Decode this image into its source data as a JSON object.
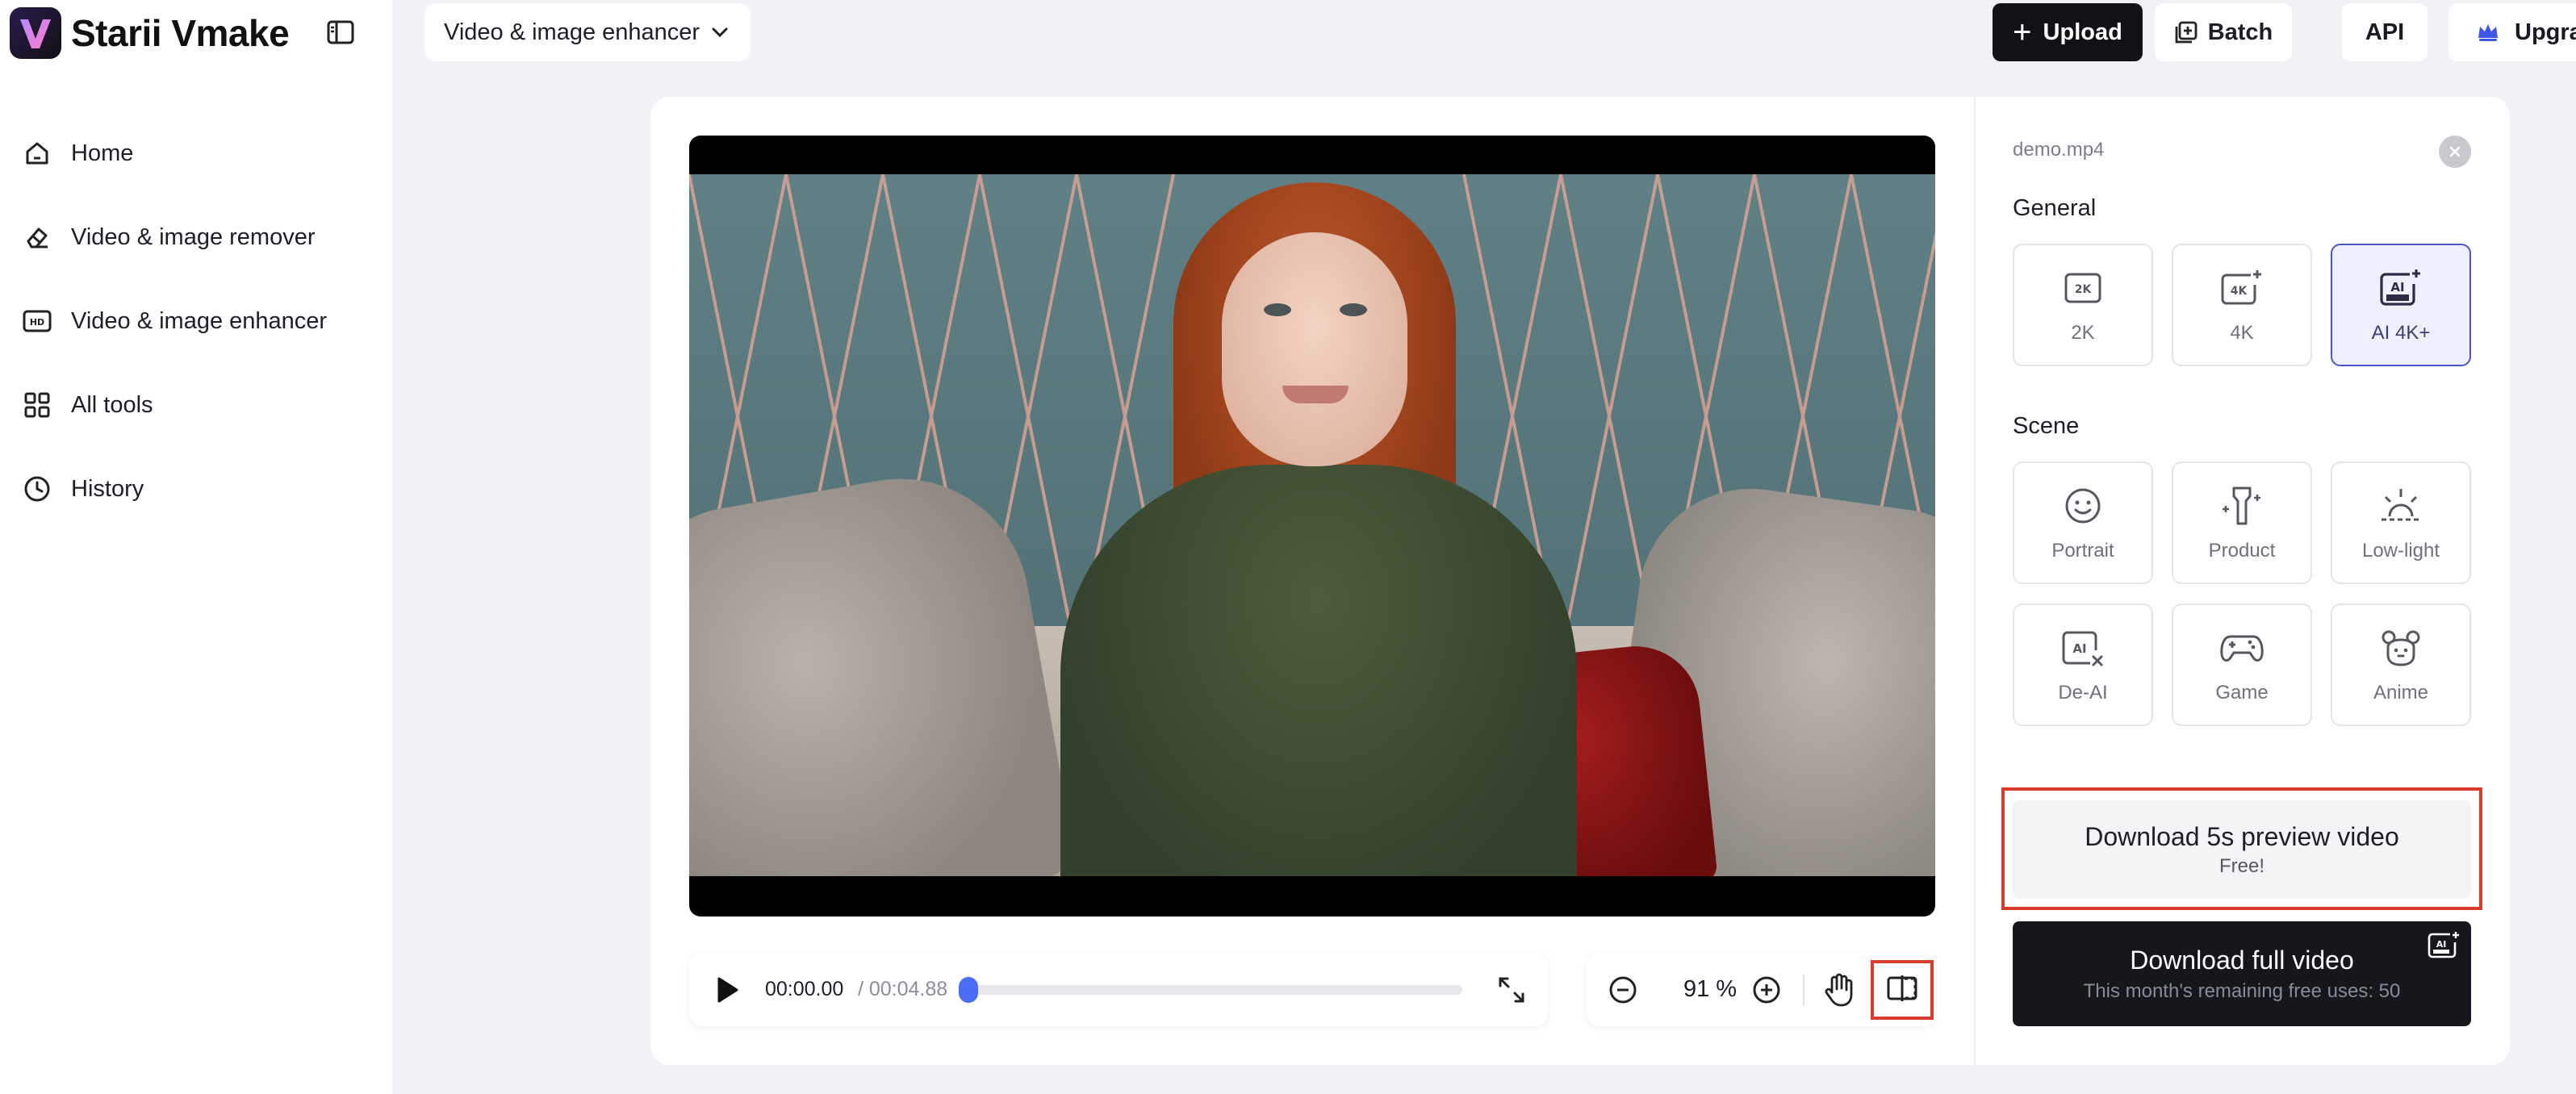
{
  "app": {
    "brand_name": "Starii Vmake",
    "accent_color": "#4a6cf7",
    "highlight_color": "#d93b2e"
  },
  "sidebar": {
    "items": [
      {
        "label": "Home",
        "icon": "home-icon"
      },
      {
        "label": "Video & image remover",
        "icon": "eraser-icon"
      },
      {
        "label": "Video & image enhancer",
        "icon": "hd-icon"
      },
      {
        "label": "All tools",
        "icon": "grid-icon"
      },
      {
        "label": "History",
        "icon": "clock-icon"
      }
    ]
  },
  "topbar": {
    "tool_select": "Video & image enhancer",
    "upload_label": "Upload",
    "batch_label": "Batch",
    "api_label": "API",
    "upgrade_label": "Upgrade"
  },
  "player": {
    "current_time": "00:00.00",
    "separator_duration": " / 00:04.88",
    "progress": 0.0
  },
  "zoom": {
    "value": "91 %"
  },
  "panel": {
    "file_name": "demo.mp4",
    "general_title": "General",
    "general_options": [
      {
        "label": "2K",
        "icon": "2k-icon",
        "selected": false
      },
      {
        "label": "4K",
        "icon": "4k-plus-icon",
        "selected": false
      },
      {
        "label": "AI 4K+",
        "icon": "ai-ultra-icon",
        "selected": true
      }
    ],
    "scene_title": "Scene",
    "scene_options": [
      {
        "label": "Portrait",
        "icon": "smile-icon"
      },
      {
        "label": "Product",
        "icon": "product-bottle-icon"
      },
      {
        "label": "Low-light",
        "icon": "sunrise-icon"
      },
      {
        "label": "De-AI",
        "icon": "ai-x-icon"
      },
      {
        "label": "Game",
        "icon": "gamepad-icon"
      },
      {
        "label": "Anime",
        "icon": "bear-icon"
      }
    ],
    "download_preview_title": "Download 5s preview video",
    "download_preview_sub": "Free!",
    "download_full_title": "Download full video",
    "download_full_sub": "This month's remaining free uses: 50"
  }
}
